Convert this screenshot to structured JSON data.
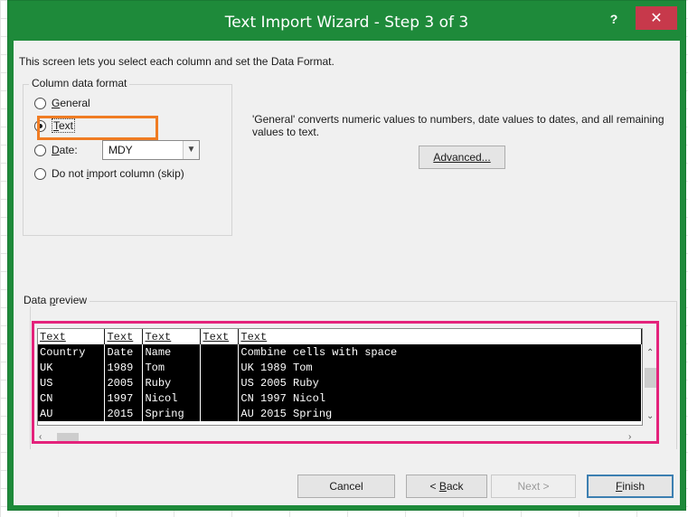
{
  "window": {
    "title": "Text Import Wizard - Step 3 of 3",
    "help_label": "?",
    "close_label": "✕"
  },
  "intro": "This screen lets you select each column and set the Data Format.",
  "column_format": {
    "legend": "Column data format",
    "options": [
      {
        "label": "General",
        "access_key": "G",
        "rest": "eneral",
        "checked": false
      },
      {
        "label": "Text",
        "access_key": "T",
        "rest": "ext",
        "checked": true
      },
      {
        "label": "Date:",
        "access_key": "D",
        "rest": "ate:",
        "checked": false
      },
      {
        "label": "Do not import column (skip)",
        "pre": "Do not ",
        "access_key": "i",
        "rest": "mport column (skip)",
        "checked": false
      }
    ],
    "date_format": "MDY"
  },
  "description": "'General' converts numeric values to numbers, date values to dates, and all remaining values to text.",
  "buttons": {
    "advanced": "Advanced...",
    "cancel": "Cancel",
    "back": "< Back",
    "back_pre": "< ",
    "back_key": "B",
    "back_rest": "ack",
    "next": "Next >",
    "finish": "Finish",
    "finish_key": "F",
    "finish_rest": "inish"
  },
  "preview": {
    "legend_pre": "Data ",
    "legend_key": "p",
    "legend_rest": "review",
    "headers": [
      "Text",
      "Text",
      "Text",
      "Text",
      "Text"
    ],
    "rows": [
      [
        "Country",
        "Date",
        "Name",
        "",
        "Combine cells with space"
      ],
      [
        "UK",
        "1989",
        "Tom",
        "",
        "UK 1989 Tom"
      ],
      [
        "US",
        "2005",
        "Ruby",
        "",
        "US 2005 Ruby"
      ],
      [
        "CN",
        "1997",
        "Nicol",
        "",
        "CN 1997 Nicol"
      ],
      [
        "AU",
        "2015",
        "Spring",
        "",
        "AU 2015 Spring"
      ]
    ]
  },
  "colors": {
    "title_bar": "#1e8a3a",
    "close_button": "#c7394b",
    "highlight_format": "#f07c23",
    "highlight_preview": "#e4227b"
  }
}
